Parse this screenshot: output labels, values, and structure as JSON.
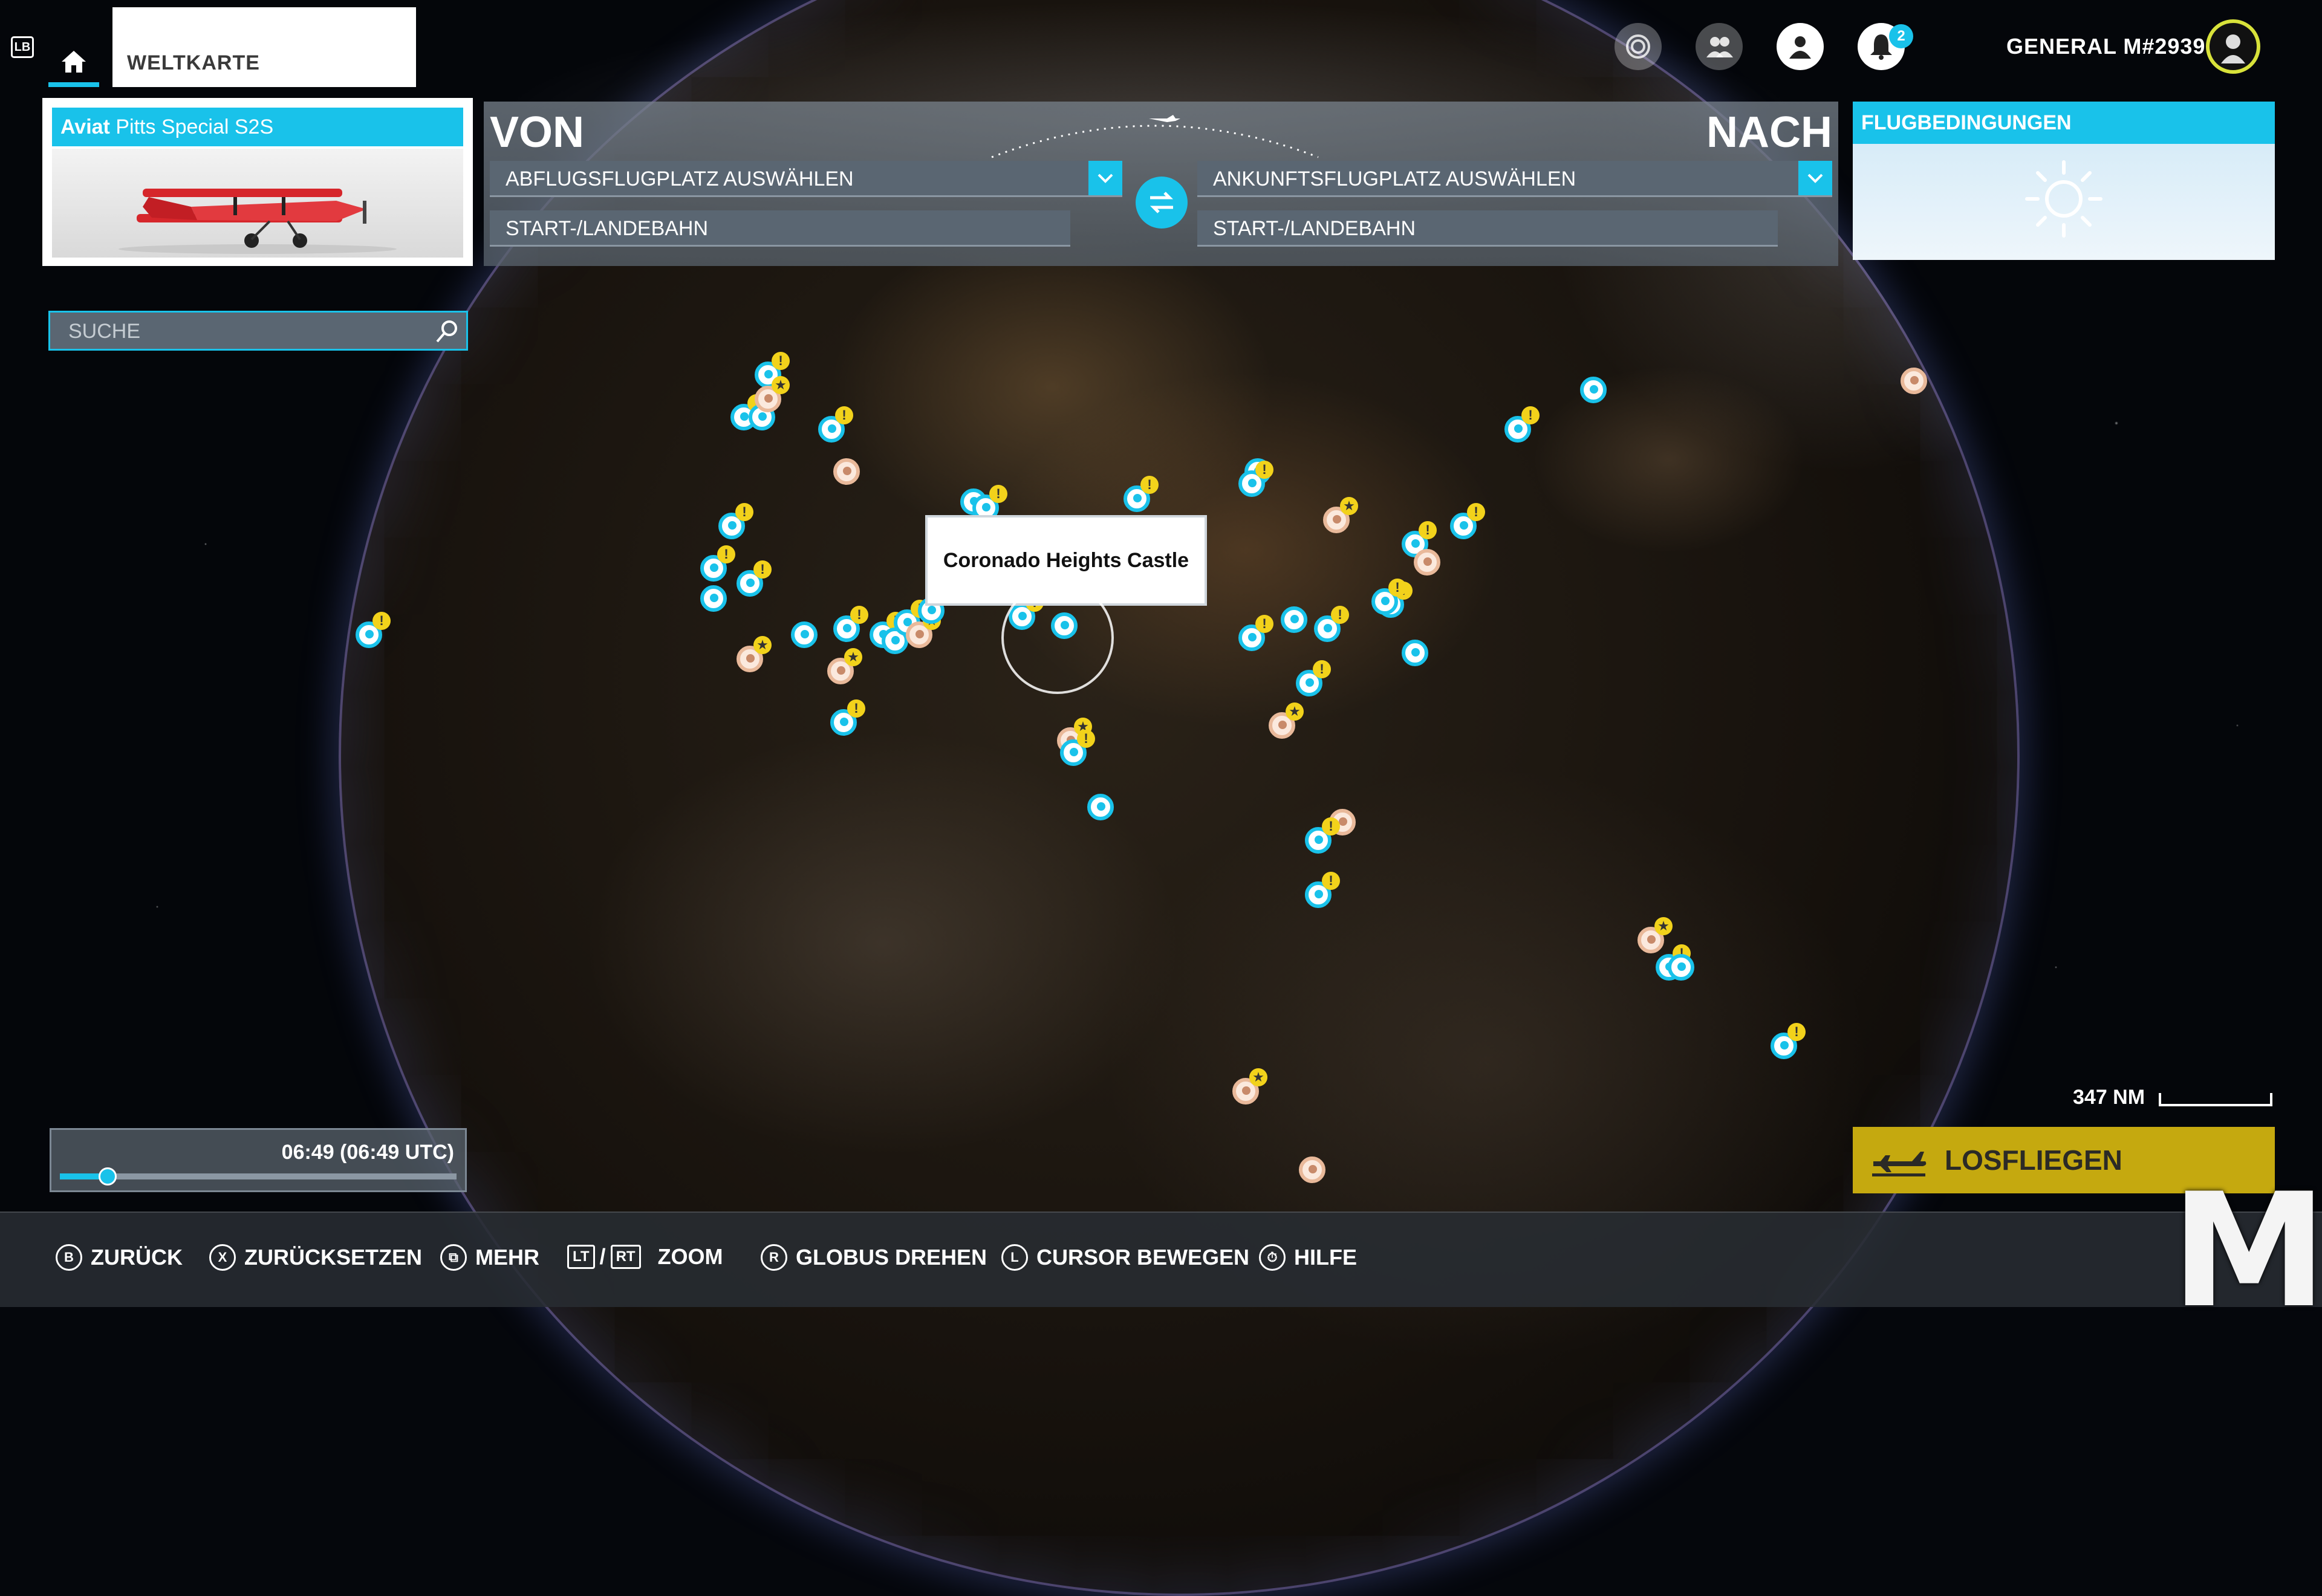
{
  "nav": {
    "lb_label": "LB",
    "tab_label": "WELTKARTE",
    "notifications_count": "2",
    "username": "GENERAL M#2939"
  },
  "aircraft": {
    "manufacturer": "Aviat",
    "model": "Pitts Special S2S"
  },
  "route": {
    "from_heading": "VON",
    "to_heading": "NACH",
    "departure_placeholder": "ABFLUGSFLUGPLATZ AUSWÄHLEN",
    "departure_runway": "START-/LANDEBAHN",
    "arrival_placeholder": "ANKUNFTSFLUGPLATZ AUSWÄHLEN",
    "arrival_runway": "START-/LANDEBAHN"
  },
  "conditions": {
    "title": "FLUGBEDINGUNGEN",
    "weather_icon": "sun-icon"
  },
  "search": {
    "placeholder": "SUCHE"
  },
  "tooltip": {
    "label": "Coronado Heights Castle"
  },
  "time": {
    "label": "06:49 (06:49 UTC)",
    "progress": 0.12
  },
  "scale": {
    "label": "347 NM"
  },
  "fly": {
    "label": "LOSFLIEGEN"
  },
  "hints": {
    "back": {
      "glyph": "B",
      "label": "ZURÜCK"
    },
    "reset": {
      "glyph": "X",
      "label": "ZURÜCKSETZEN"
    },
    "more": {
      "glyph": "⧉",
      "label": "MEHR"
    },
    "zoom": {
      "lt": "LT",
      "rt": "RT",
      "label": "ZOOM"
    },
    "rotate": {
      "glyph": "R",
      "label": "GLOBUS DREHEN"
    },
    "cursor": {
      "glyph": "L",
      "label": "CURSOR BEWEGEN"
    },
    "help": {
      "glyph": "⏱",
      "label": "HILFE"
    }
  },
  "watermark": "M",
  "colors": {
    "accent": "#19c2ea",
    "fly_button": "#c5a90f",
    "badge": "#f2d21b"
  }
}
